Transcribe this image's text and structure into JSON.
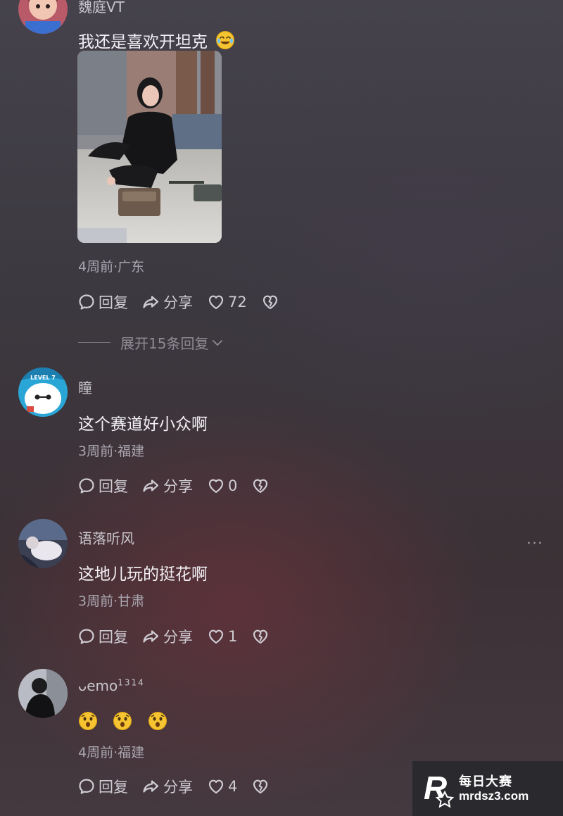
{
  "comments": [
    {
      "username": "魏庭VT",
      "text": "我还是喜欢开坦克",
      "text_emoji": "laughing-tears-emoji",
      "has_image": true,
      "time_location": "4周前·广东",
      "reply_label": "回复",
      "share_label": "分享",
      "likes": "72",
      "expand_label": "展开15条回复"
    },
    {
      "username": "瞳",
      "text": "这个赛道好小众啊",
      "time_location": "3周前·福建",
      "reply_label": "回复",
      "share_label": "分享",
      "likes": "0"
    },
    {
      "username": "语落听风",
      "text": "这地儿玩的挺花啊",
      "time_location": "3周前·甘肃",
      "reply_label": "回复",
      "share_label": "分享",
      "likes": "1",
      "more_label": "···"
    },
    {
      "username": "ᴗemo",
      "username_sup": "1314",
      "text_emojis": [
        "surprised-emoji",
        "surprised-emoji",
        "surprised-emoji"
      ],
      "time_location": "4周前·福建",
      "reply_label": "回复",
      "share_label": "分享",
      "likes": "4"
    }
  ],
  "watermark": {
    "title": "每日大赛",
    "url": "mrdsz3.com",
    "logo_letter": "R"
  }
}
